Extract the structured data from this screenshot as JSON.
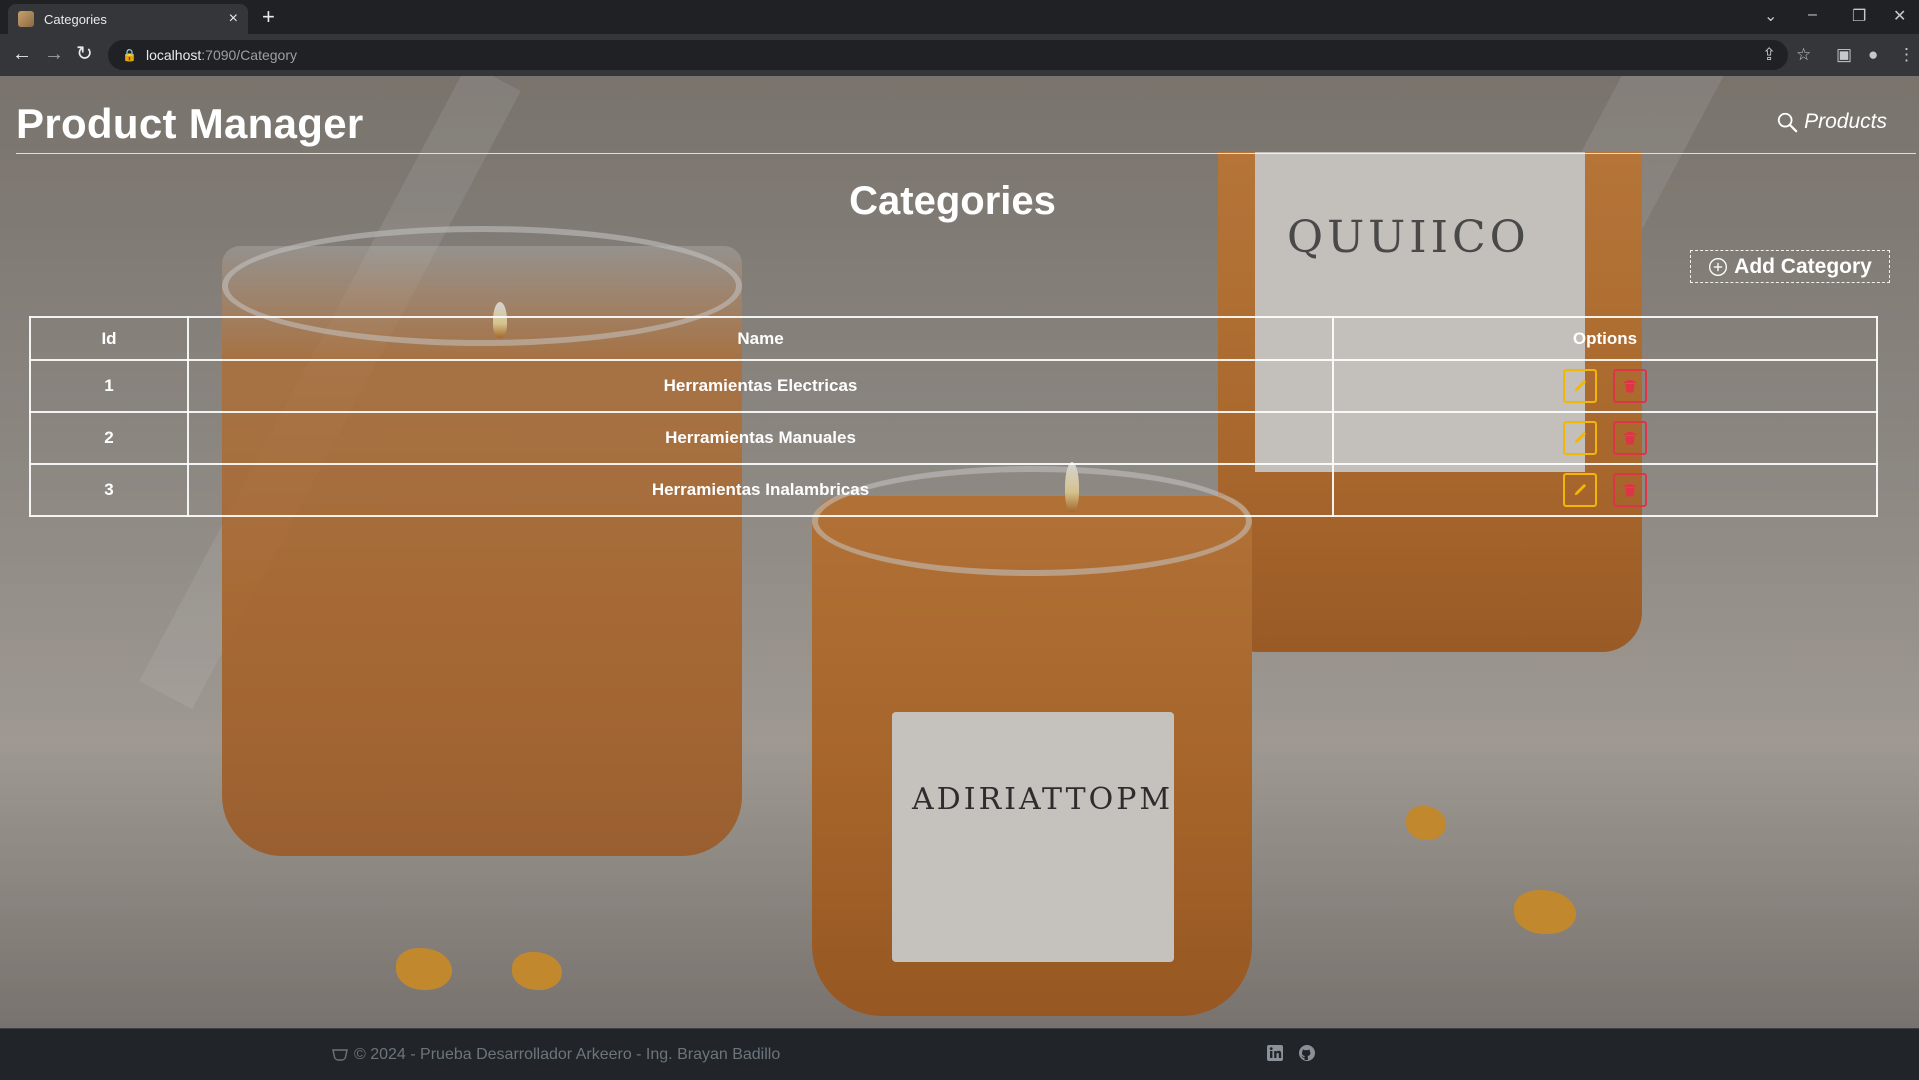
{
  "browser": {
    "tab_title": "Categories",
    "tab_close": "×",
    "new_tab": "+",
    "url_host": "localhost",
    "url_rest": ":7090/Category"
  },
  "app": {
    "brand": "Product Manager",
    "nav_products": "Products",
    "heading": "Categories",
    "add_button": "Add Category"
  },
  "table": {
    "headers": [
      "Id",
      "Name",
      "Options"
    ],
    "rows": [
      {
        "id": "1",
        "name": "Herramientas Electricas"
      },
      {
        "id": "2",
        "name": "Herramientas Manuales"
      },
      {
        "id": "3",
        "name": "Herramientas Inalambricas"
      }
    ]
  },
  "footer": {
    "text": "© 2024 - Prueba Desarrollador Arkeero - Ing. Brayan Badillo"
  },
  "background_image": {
    "label_candle": "ADIRIATTOPM",
    "label_bottle": "QUUIICO"
  },
  "colors": {
    "edit_accent": "#f2b705",
    "delete_accent": "#dc3545",
    "footer_bg": "#212529"
  },
  "icons": {
    "nav_products": "search-icon",
    "add": "plus-circle-icon",
    "edit": "pencil-icon",
    "delete": "trash-icon",
    "footer_logo": "cup-icon",
    "social_1": "linkedin-icon",
    "social_2": "github-icon"
  }
}
